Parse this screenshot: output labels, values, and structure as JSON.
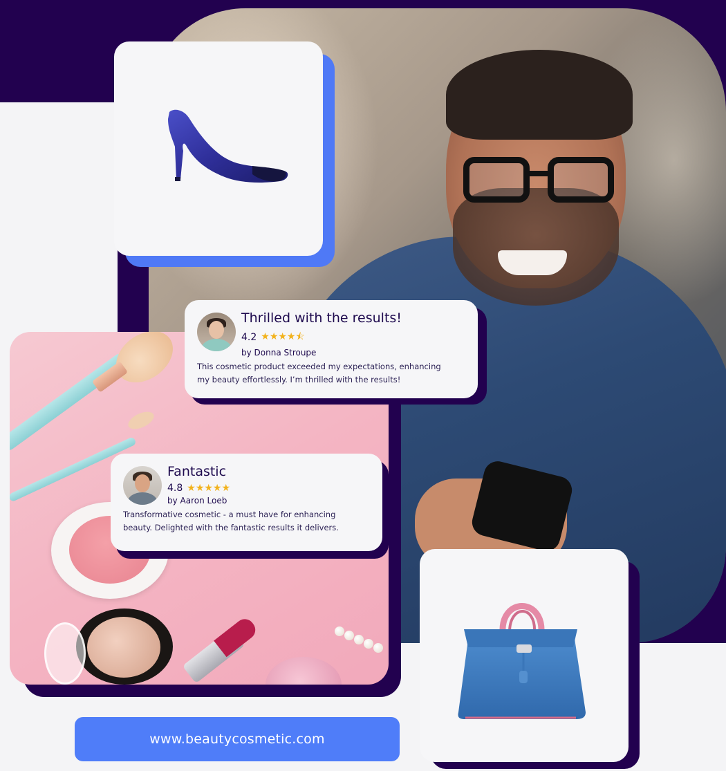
{
  "colors": {
    "dark_purple": "#22014f",
    "accent_blue": "#4f7df9",
    "star_gold": "#f2b21c",
    "card_bg": "#f6f6f8",
    "pink_bg": "#f4b5c3"
  },
  "products": {
    "shoe": {
      "icon": "high-heel-shoe-icon"
    },
    "bag": {
      "icon": "handbag-icon"
    }
  },
  "reviews": [
    {
      "title": "Thrilled with the results!",
      "rating": "4.2",
      "rating_value": 4.2,
      "stars": "★★★★⯪",
      "author": "by Donna Stroupe",
      "body": "This cosmetic product exceeded my expectations, enhancing my beauty effortlessly. I’m thrilled with the results!"
    },
    {
      "title": "Fantastic",
      "rating": "4.8",
      "rating_value": 4.8,
      "stars": "★★★★★",
      "author": "by Aaron Loeb",
      "body": "Transformative cosmetic - a must have for enhancing beauty. Delighted with the fantastic results it delivers."
    }
  ],
  "website": {
    "url": "www.beautycosmetic.com"
  }
}
